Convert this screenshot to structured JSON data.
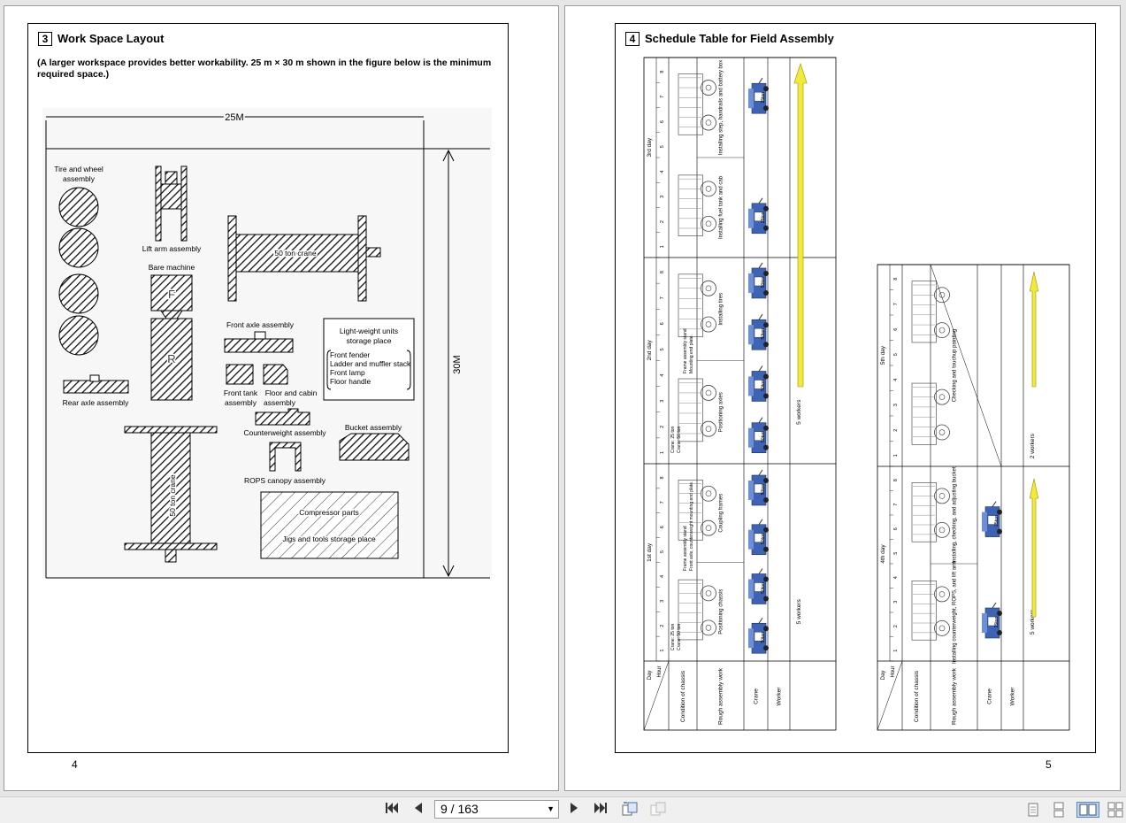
{
  "left_page": {
    "section_number": "3",
    "section_title": "Work Space Layout",
    "intro_line1": "(A larger workspace provides better workability. 25 m × 30 m shown in the figure below is the minimum",
    "intro_line2": "required space.)",
    "page_number": "4",
    "layout": {
      "dim_width": "25M",
      "dim_height": "30M",
      "tire_line1": "Tire and wheel",
      "tire_line2": "assembly",
      "lift_arm": "Lift arm assembly",
      "bare_machine": "Bare machine",
      "front_letter": "F",
      "rear_letter": "R",
      "crane_50_h": "50 ton crane",
      "front_axle": "Front axle assembly",
      "lw_title1": "Light-weight units",
      "lw_title2": "storage place",
      "lw_items": [
        "Front fender",
        "Ladder and muffler stack",
        "Front lamp",
        "Floor handle"
      ],
      "front_tank1": "Front tank",
      "front_tank2": "assembly",
      "floor_cabin1": "Floor and cabin",
      "floor_cabin2": "assembly",
      "rear_axle": "Rear axle assembly",
      "counterweight": "Counterweight assembly",
      "bucket": "Bucket assembly",
      "rops": "ROPS canopy assembly",
      "crane_50_v": "50 ton crane",
      "compressor": "Compressor parts",
      "jigs": "Jigs and tools storage place"
    }
  },
  "right_page": {
    "section_number": "4",
    "section_title": "Schedule Table for Field Assembly",
    "page_number": "5",
    "schedule": {
      "header_day": "Day",
      "header_hour": "Hour",
      "row_labels": [
        "Condition of chassis",
        "Rough assembly work",
        "Crane",
        "Worker"
      ],
      "days": [
        "1st day",
        "2nd day",
        "3rd day",
        "4th day",
        "5th day"
      ],
      "hours": [
        "1",
        "2",
        "3",
        "4",
        "5",
        "6",
        "7",
        "8"
      ],
      "day1_work": [
        "Positioning chassis",
        "Coupling frames"
      ],
      "day1_notes": [
        "Crane: 25 ton",
        "Crane: 50 ton",
        "Frame assembly stand",
        "Front axle, counterweight mounting end plate."
      ],
      "day2_work": [
        "Positioning axles",
        "Installing tires"
      ],
      "day2_notes": [
        "Crane: 25 ton",
        "Crane: 50 ton",
        "Frame assembly stand",
        "Mounting end plate."
      ],
      "day3_work": [
        "Installing fuel tank and cab",
        "Installing step, handrails and battery box"
      ],
      "day4_work": [
        "Installing counterweight, ROPS, and lift arm",
        "Installing, checking, and adjusting bucket"
      ],
      "day5_work": [
        "Checking and touchup painting"
      ],
      "crane_50": "50ton",
      "crane_25": "25ton",
      "workers_5": "5 workers",
      "workers_2": "2 workers"
    }
  },
  "toolbar": {
    "page_indicator": "9 / 163",
    "first_page": "first-page",
    "prev_page": "previous-page",
    "next_page": "next-page",
    "last_page": "last-page"
  },
  "colors": {
    "arrow_yellow": "#f2ea3a",
    "crane_blue": "#3c63b5"
  }
}
